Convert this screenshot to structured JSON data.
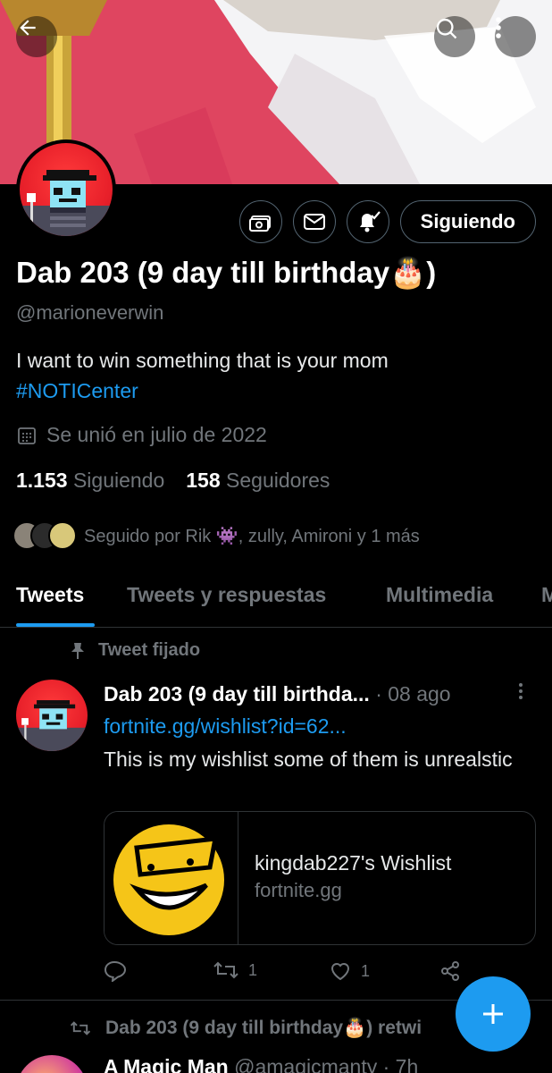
{
  "header": {
    "back_icon": "arrow-left-icon",
    "search_icon": "search-icon",
    "more_icon": "more-vertical-icon"
  },
  "profile": {
    "display_name": "Dab 203 (9 day till birthday🎂)",
    "handle": "@marioneverwin",
    "bio_text": "I want to win something that is your mom",
    "bio_hashtag": "#NOTICenter",
    "joined": "Se unió en julio de 2022",
    "following_count": "1.153",
    "following_label": "Siguiendo",
    "followers_count": "158",
    "followers_label": "Seguidores",
    "followed_by": "Seguido por Rik 👾, zully, Amironi y 1 más"
  },
  "actions": {
    "follow_label": "Siguiendo"
  },
  "tabs": [
    {
      "label": "Tweets"
    },
    {
      "label": "Tweets y respuestas"
    },
    {
      "label": "Multimedia"
    },
    {
      "label": "M"
    }
  ],
  "pinned_tweet": {
    "pinned_label": "Tweet fijado",
    "author": "Dab 203 (9 day till birthda...",
    "time": "· 08 ago",
    "link": "fortnite.gg/wishlist?id=62...",
    "text": "This is my wishlist some of them is unrealstic",
    "card_title": "kingdab227's Wishlist",
    "card_domain": "fortnite.gg",
    "retweets": "1",
    "likes": "1"
  },
  "next_item": {
    "retweet_line": "Dab 203 (9 day till birthday🎂) retwi",
    "author": "A Magic Man",
    "handle_time": "@amagicmanty · 7h"
  },
  "colors": {
    "accent": "#1d9bf0",
    "background": "#000000",
    "muted": "#71767b"
  }
}
